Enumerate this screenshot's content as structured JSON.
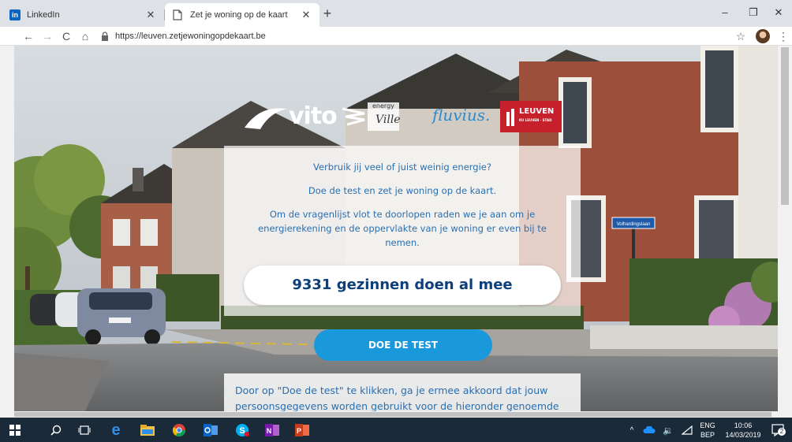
{
  "browser": {
    "tabs": [
      {
        "title": "LinkedIn",
        "favicon": "linkedin-icon",
        "active": false
      },
      {
        "title": "Zet je woning op de kaart",
        "favicon": "document-icon",
        "active": true
      }
    ],
    "new_tab": "+",
    "url": "https://leuven.zetjewoningopdekaart.be",
    "controls": {
      "minimize": "–",
      "restore": "❐",
      "close": "✕",
      "back": "←",
      "forward": "→",
      "reload": "C",
      "home": "⌂",
      "star": "☆",
      "menu": "⋮"
    }
  },
  "page": {
    "logos": {
      "vito": "vito",
      "energy": "energy",
      "ville": "Ville",
      "fluvius": "fluvius.",
      "leuven": "LEUVEN",
      "leuven_sub": "KU LEUVEN · STAD"
    },
    "intro": {
      "line1": "Verbruik jij veel of juist weinig energie?",
      "line2": "Doe de test en zet je woning op de kaart.",
      "line3a": "Om de vragenlijst vlot te doorlopen raden we je aan om je",
      "line3b": "energierekening en de oppervlakte van je woning er even bij te",
      "line3c": "nemen."
    },
    "counter": "9331 gezinnen doen al mee",
    "cta": "DOE DE TEST",
    "consent_line1": "Door op \"Doe de test\" te klikken, ga je ermee akkoord dat jouw",
    "consent_line2": "persoonsgegevens worden gebruikt voor de hieronder genoemde",
    "street_sign": "Volhardingslaan"
  },
  "taskbar": {
    "lang": "ENG",
    "lang_sub": "BEP",
    "time": "10:06",
    "date": "14/03/2019",
    "notifications": "2",
    "apps": [
      "windows-start-icon",
      "search-icon",
      "task-view-icon",
      "edge-icon",
      "file-explorer-icon",
      "chrome-icon",
      "outlook-icon",
      "skype-icon",
      "onenote-icon",
      "powerpoint-icon"
    ]
  },
  "colors": {
    "accent_blue": "#1a98dc",
    "counter_text": "#0d3f7a",
    "text_blue": "#2a6fb0",
    "leuven_red": "#c6202c",
    "taskbar": "#1b2a38"
  }
}
